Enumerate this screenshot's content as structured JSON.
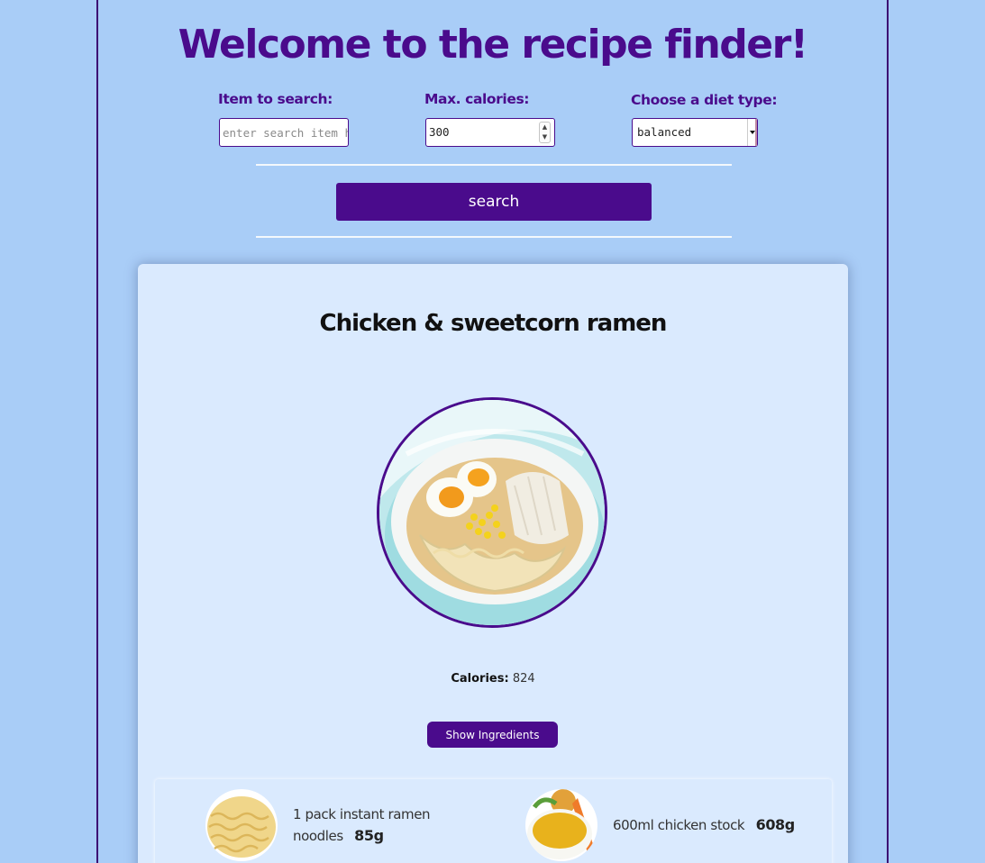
{
  "header": {
    "title": "Welcome to the recipe finder!"
  },
  "search_form": {
    "item_label": "Item to search:",
    "item_placeholder": "enter search item here",
    "calories_label": "Max. calories:",
    "calories_value": "300",
    "diet_label": "Choose a diet type:",
    "diet_selected": "balanced",
    "search_button": "search"
  },
  "recipe": {
    "title": "Chicken & sweetcorn ramen",
    "image_icon": "ramen-bowl-photo",
    "calories_label": "Calories:",
    "calories_value": "824",
    "show_ingredients_button": "Show Ingredients",
    "ingredients": [
      {
        "text": "1 pack instant ramen",
        "text_line2": "noodles",
        "weight": "85g",
        "image_icon": "ramen-noodles-photo"
      },
      {
        "text": "600ml chicken stock",
        "weight": "608g",
        "image_icon": "chicken-stock-photo"
      }
    ]
  },
  "colors": {
    "background": "#a9cdf7",
    "accent": "#4a0b8c",
    "card": "#daeafe"
  }
}
